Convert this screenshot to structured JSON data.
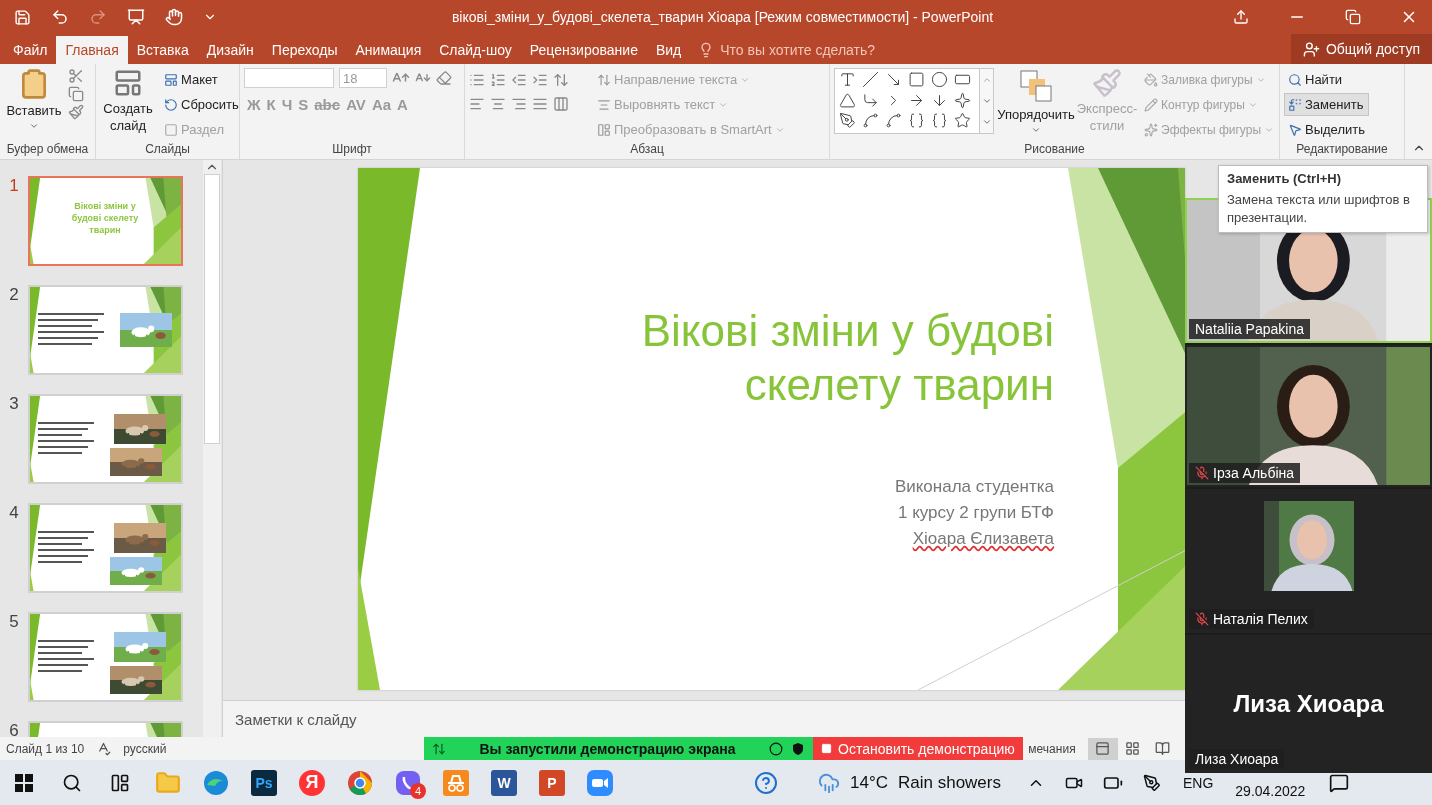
{
  "window": {
    "title": "вікові_зміни_у_будові_скелета_тварин Хіоара [Режим совместимости] - PowerPoint"
  },
  "tabs": [
    {
      "label": "Файл",
      "selected": false
    },
    {
      "label": "Главная",
      "selected": true
    },
    {
      "label": "Вставка",
      "selected": false
    },
    {
      "label": "Дизайн",
      "selected": false
    },
    {
      "label": "Переходы",
      "selected": false
    },
    {
      "label": "Анимация",
      "selected": false
    },
    {
      "label": "Слайд-шоу",
      "selected": false
    },
    {
      "label": "Рецензирование",
      "selected": false
    },
    {
      "label": "Вид",
      "selected": false
    }
  ],
  "tell_me": {
    "placeholder": "Что вы хотите сделать?"
  },
  "share_button": {
    "label": "Общий доступ"
  },
  "ribbon": {
    "clipboard": {
      "label": "Буфер обмена",
      "paste": "Вставить"
    },
    "slides": {
      "label": "Слайды",
      "new_slide": "Создать слайд",
      "items": [
        {
          "label": "Макет",
          "disabled": false
        },
        {
          "label": "Сбросить",
          "disabled": false
        },
        {
          "label": "Раздел",
          "disabled": true
        }
      ]
    },
    "font": {
      "label": "Шрифт",
      "size": "18",
      "disabled": true,
      "buttons": [
        "Ж",
        "К",
        "Ч",
        "S",
        "abc",
        "AV",
        "Aa",
        "A"
      ]
    },
    "paragraph": {
      "label": "Абзац",
      "disabled": true,
      "items": [
        "Направление текста",
        "Выровнять текст",
        "Преобразовать в SmartArt"
      ]
    },
    "drawing": {
      "label": "Рисование",
      "arrange": "Упорядочить",
      "quick_styles": {
        "label": "Экспресс-стили",
        "disabled": true
      },
      "items": [
        {
          "label": "Заливка фигуры",
          "disabled": true
        },
        {
          "label": "Контур фигуры",
          "disabled": true
        },
        {
          "label": "Эффекты фигуры",
          "disabled": true
        }
      ]
    },
    "editing": {
      "label": "Редактирование",
      "items": [
        {
          "label": "Найти",
          "hovered": false
        },
        {
          "label": "Заменить",
          "hovered": true
        },
        {
          "label": "Выделить",
          "hovered": false
        }
      ]
    }
  },
  "thumbnails": [
    {
      "number": "1",
      "selected": true,
      "kind": "title",
      "title": "Вікові зміни у будові скелету тварин"
    },
    {
      "number": "2",
      "selected": false,
      "kind": "text_photo"
    },
    {
      "number": "3",
      "selected": false,
      "kind": "text_two_photos"
    },
    {
      "number": "4",
      "selected": false,
      "kind": "text_two_photos"
    },
    {
      "number": "5",
      "selected": false,
      "kind": "text_two_photos"
    },
    {
      "number": "6",
      "selected": false,
      "kind": "cut_off"
    }
  ],
  "slide": {
    "title": "Вікові зміни у будові скелету тварин",
    "subtitle": [
      {
        "text": "Виконала студентка",
        "misspelled": false
      },
      {
        "text": "1 курсу 2 групи БТФ",
        "misspelled": false
      },
      {
        "text": "Хіоара Єлизавета",
        "misspelled": true
      }
    ]
  },
  "notes": {
    "placeholder": "Заметки к слайду"
  },
  "status_bar": {
    "slide": "Слайд 1 из 10",
    "language": "русский",
    "notes": "мечания",
    "views": [
      {
        "kind": "normal",
        "selected": true
      },
      {
        "kind": "sorter",
        "selected": false
      },
      {
        "kind": "reading",
        "selected": false
      }
    ]
  },
  "screen_share": {
    "message": "Вы запустили демонстрацию экрана",
    "stop": "Остановить демонстрацию"
  },
  "tooltip": {
    "title": "Заменить (Ctrl+H)",
    "text": "Замена текста или шрифтов в презентации."
  },
  "participants": [
    {
      "name": "Nataliia Papakina",
      "kind": "video",
      "muted": false,
      "speaking": true
    },
    {
      "name": "Ірза Альбіна",
      "kind": "video",
      "muted": true,
      "speaking": false
    },
    {
      "name": "Наталія Пелих",
      "kind": "avatar",
      "muted": true,
      "speaking": false
    },
    {
      "name": "Лиза Хиоара",
      "kind": "name_only",
      "display_name": "Лиза Хиоара",
      "muted": false,
      "speaking": false
    }
  ],
  "taskbar": {
    "apps": [
      {
        "kind": "folder"
      },
      {
        "kind": "edge"
      },
      {
        "kind": "photoshop",
        "label": "Ps"
      },
      {
        "kind": "yandex",
        "label": "Я"
      },
      {
        "kind": "chrome"
      },
      {
        "kind": "viber",
        "badge": "4"
      },
      {
        "kind": "incognito"
      },
      {
        "kind": "word",
        "label": "W"
      },
      {
        "kind": "powerpoint",
        "label": "P"
      },
      {
        "kind": "zoom"
      }
    ],
    "weather": {
      "temperature": "14°C",
      "text": "Rain showers"
    },
    "language": "ENG",
    "date": "29.04.2022"
  }
}
